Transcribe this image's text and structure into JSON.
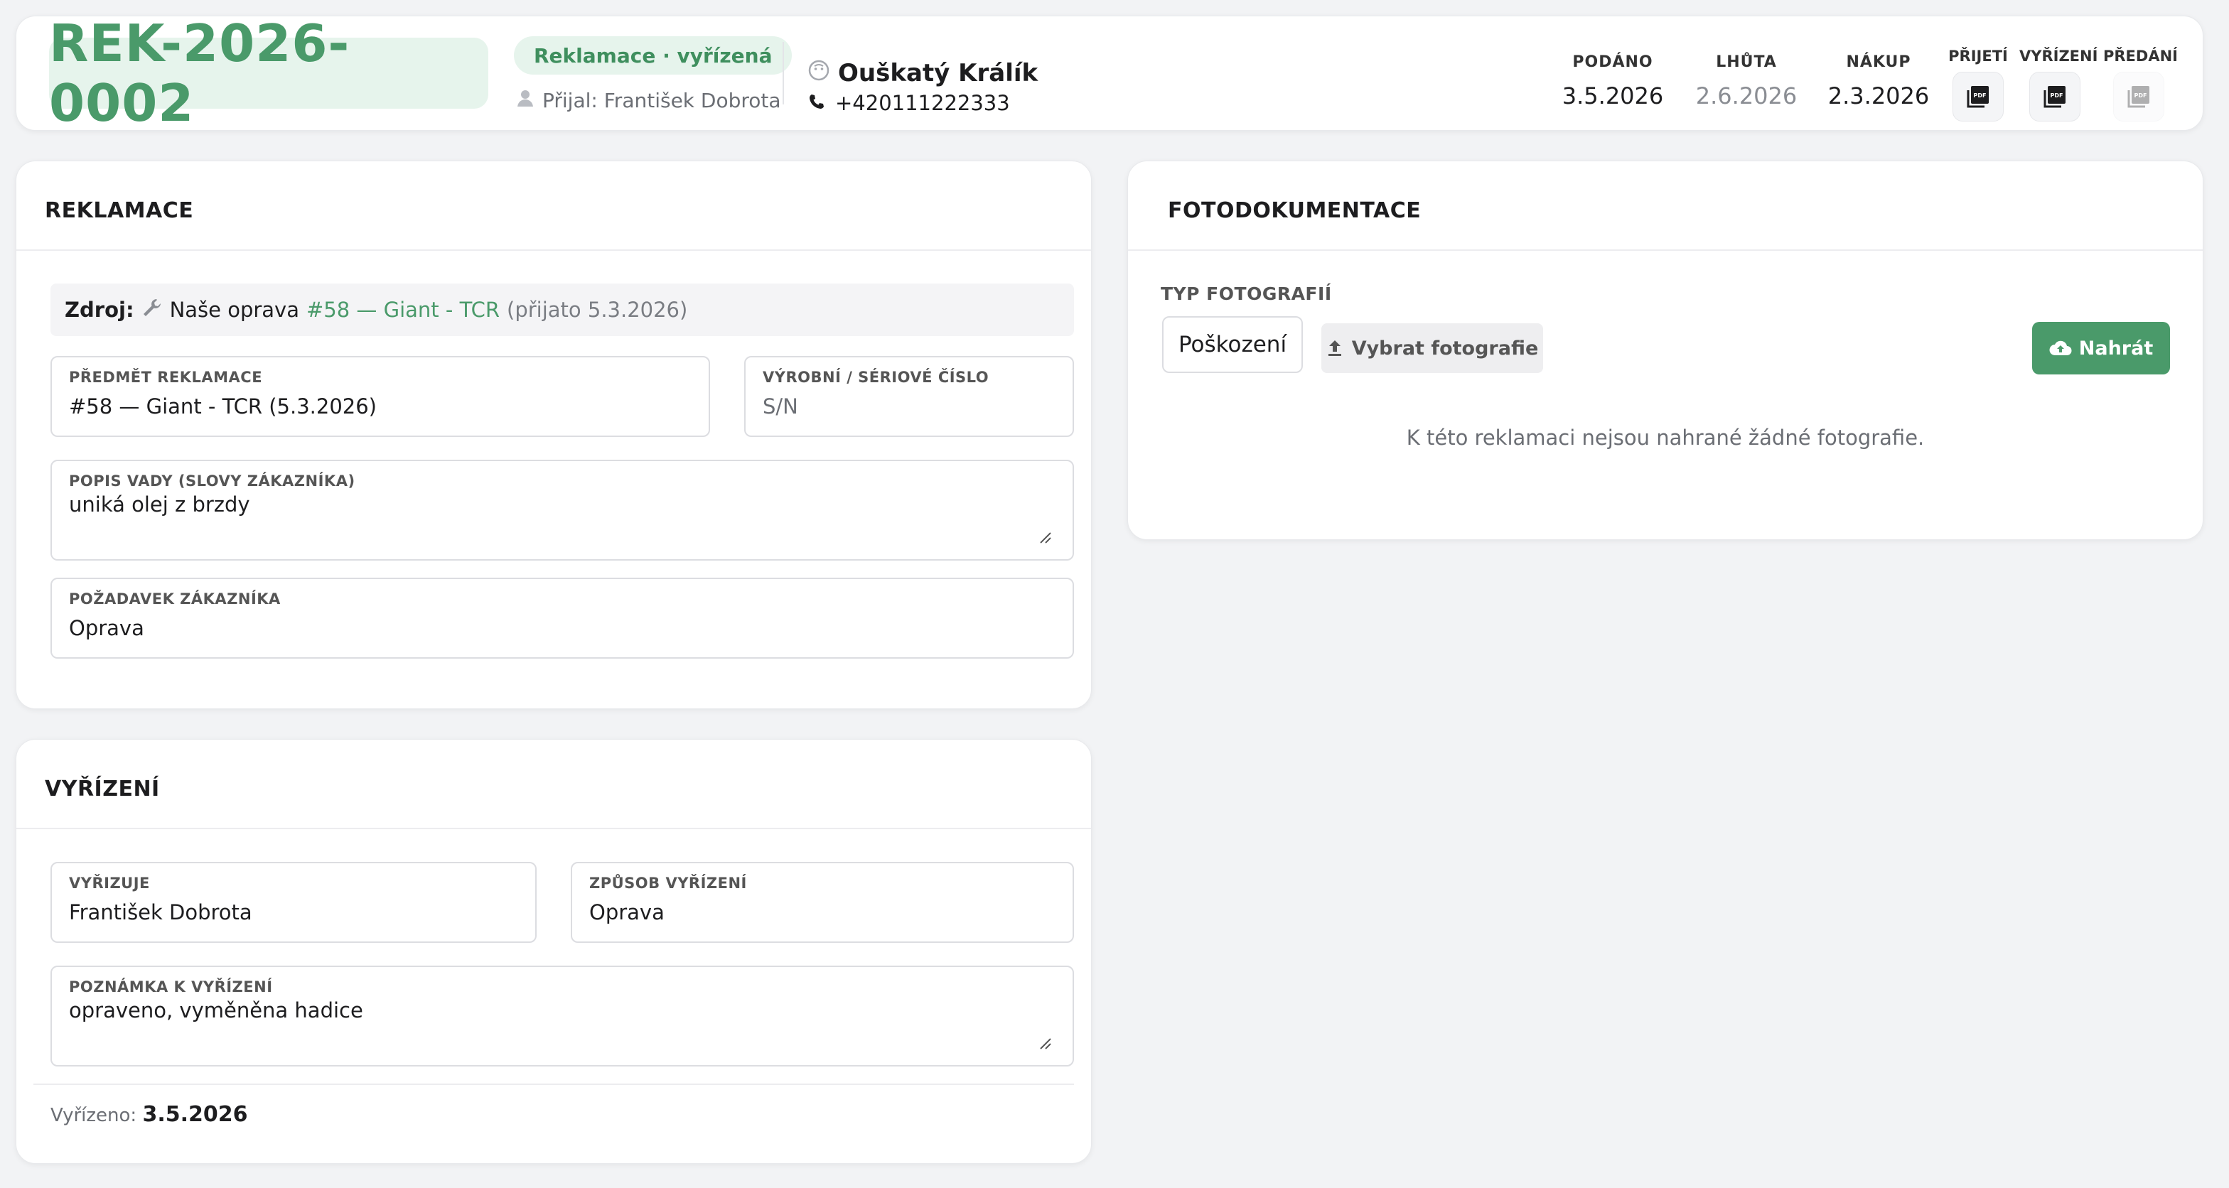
{
  "header": {
    "id": "REK-2026-0002",
    "status": "Reklamace · vyřízená",
    "received_by": "Přijal: František Dobrota",
    "customer_name": "Ouškatý Králík",
    "customer_phone": "+420111222333",
    "dates": [
      {
        "label": "PODÁNO",
        "value": "3.5.2026"
      },
      {
        "label": "LHŮTA",
        "value": "2.6.2026"
      },
      {
        "label": "NÁKUP",
        "value": "2.3.2026"
      }
    ],
    "pdfs": [
      {
        "label": "PŘIJETÍ",
        "enabled": true
      },
      {
        "label": "VYŘÍZENÍ",
        "enabled": true
      },
      {
        "label": "PŘEDÁNÍ",
        "enabled": false
      }
    ]
  },
  "reklamace": {
    "title": "REKLAMACE",
    "source": {
      "label": "Zdroj:",
      "icon": "wrench-icon",
      "text": "Naše oprava",
      "link": "#58 — Giant - TCR",
      "note": "(přijato 5.3.2026)"
    },
    "subject": {
      "label": "PŘEDMĚT REKLAMACE",
      "value": "#58 — Giant - TCR (5.3.2026)"
    },
    "serial": {
      "label": "VÝROBNÍ / SÉRIOVÉ ČÍSLO",
      "placeholder": "S/N"
    },
    "defect": {
      "label": "POPIS VADY (SLOVY ZÁKAZNÍKA)",
      "value": "uniká olej z brzdy"
    },
    "request": {
      "label": "POŽADAVEK ZÁKAZNÍKA",
      "value": "Oprava"
    }
  },
  "vyrizeni": {
    "title": "VYŘÍZENÍ",
    "handler": {
      "label": "VYŘIZUJE",
      "value": "František Dobrota"
    },
    "method": {
      "label": "ZPŮSOB VYŘÍZENÍ",
      "value": "Oprava"
    },
    "note": {
      "label": "POZNÁMKA K VYŘÍZENÍ",
      "value": "opraveno, vyměněna hadice"
    },
    "resolved_label": "Vyřízeno:",
    "resolved_date": "3.5.2026"
  },
  "foto": {
    "title": "FOTODOKUMENTACE",
    "type_label": "TYP FOTOGRAFIÍ",
    "type_value": "Poškození",
    "choose_label": "Vybrat fotografie",
    "upload_label": "Nahrát",
    "empty_message": "K této reklamaci nejsou nahrané žádné fotografie."
  },
  "colors": {
    "accent": "#4a9a6a",
    "accent_bg": "#e6f4ec",
    "background": "#f2f3f5"
  }
}
